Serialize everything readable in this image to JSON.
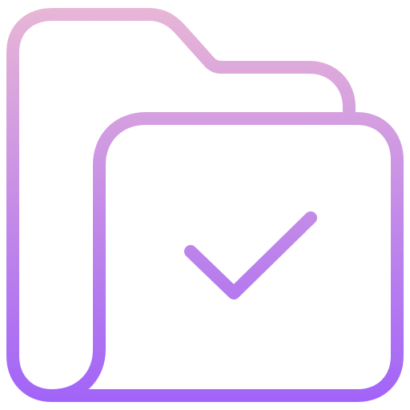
{
  "icon": {
    "name": "folder-check-icon",
    "gradient": {
      "top": "#E8B6D6",
      "bottom": "#A264F8"
    }
  }
}
